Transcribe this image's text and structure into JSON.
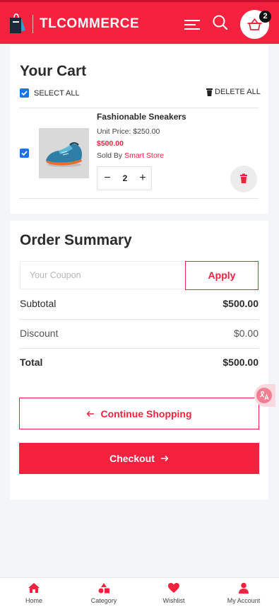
{
  "header": {
    "brand": "TLCOMMERCE",
    "cart_count": "2",
    "colors": {
      "primary": "#f5223f",
      "dark_accent": "#2a9fd6"
    },
    "icons": [
      "logo-bag-icon",
      "menu-icon",
      "search-icon",
      "cart-basket-icon"
    ]
  },
  "cart": {
    "title": "Your Cart",
    "select_all": "SELECT ALL",
    "delete_all": "DELETE ALL",
    "items": [
      {
        "name": "Fashionable Sneakers",
        "unit_price": "Unit Price: $250.00",
        "total": "$500.00",
        "sold_by_prefix": "Sold By ",
        "store": "Smart Store",
        "quantity": "2",
        "minus": "−",
        "plus": "+"
      }
    ]
  },
  "summary": {
    "title": "Order Summary",
    "coupon_placeholder": "Your Coupon",
    "apply": "Apply",
    "subtotal_label": "Subtotal",
    "subtotal_value": "$500.00",
    "discount_label": "Discount",
    "discount_value": "$0.00",
    "total_label": "Total",
    "total_value": "$500.00",
    "continue": "Continue Shopping",
    "checkout": "Checkout"
  },
  "nav": {
    "items": [
      {
        "label": "Home",
        "icon": "home-icon"
      },
      {
        "label": "Category",
        "icon": "category-icon"
      },
      {
        "label": "Wishlist",
        "icon": "heart-icon"
      },
      {
        "label": "My Account",
        "icon": "user-icon"
      }
    ]
  }
}
